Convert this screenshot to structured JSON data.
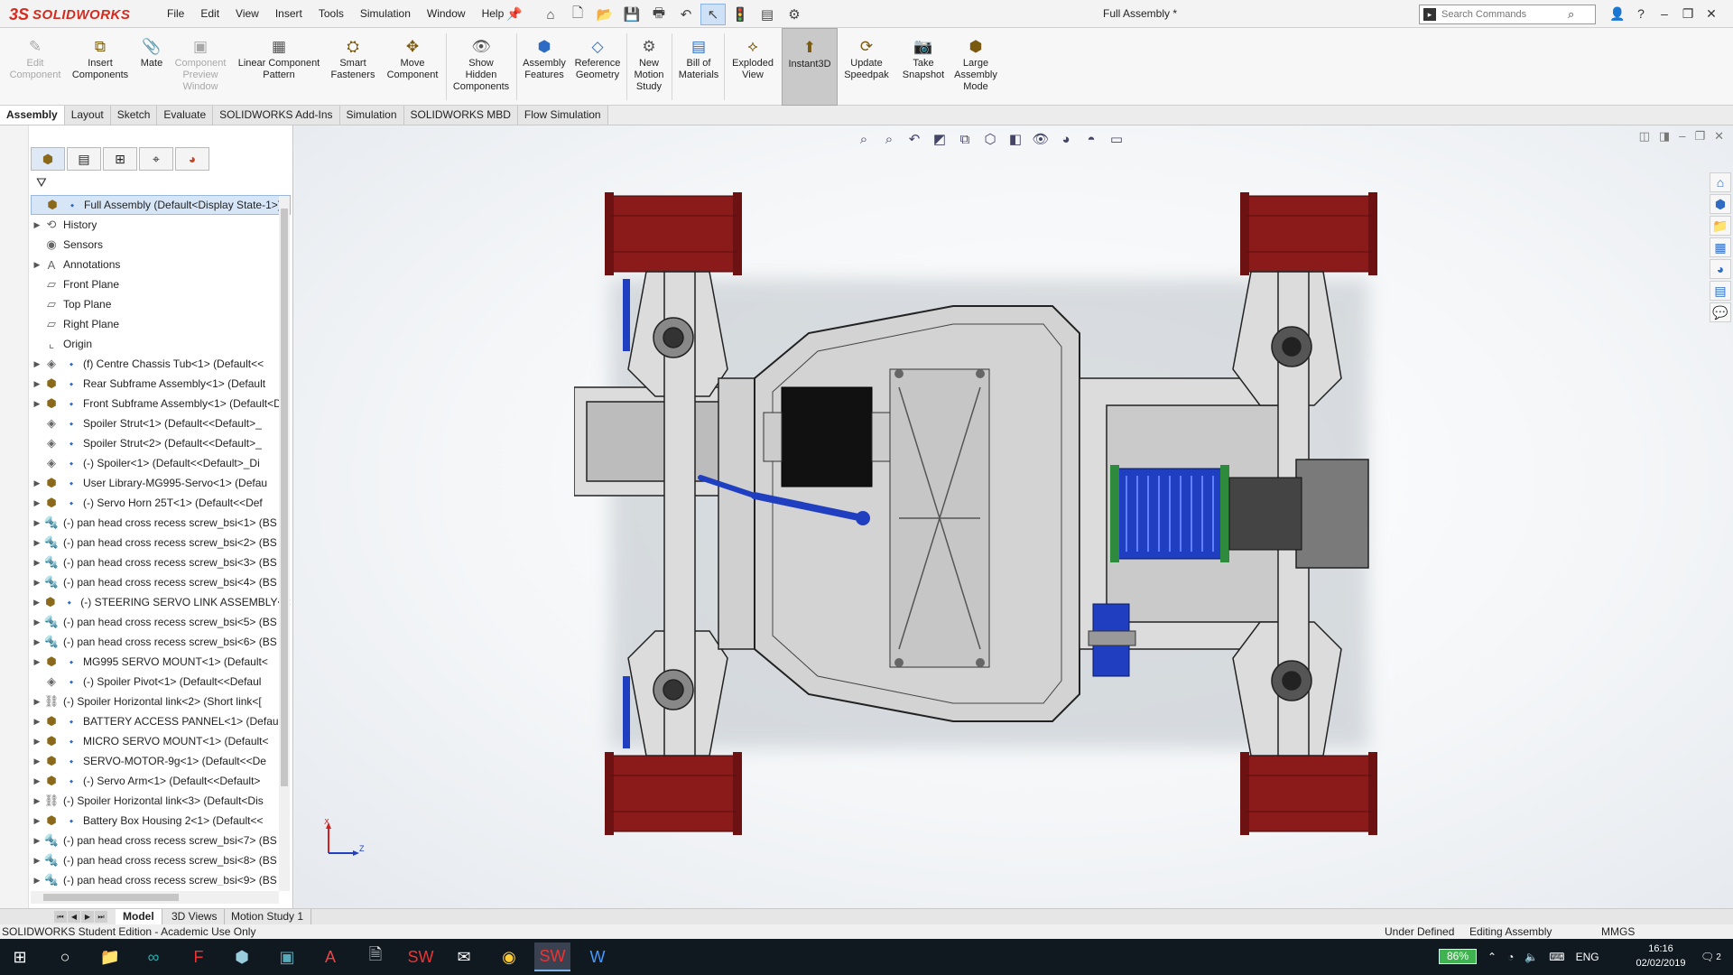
{
  "app": {
    "logo_ds": "3S",
    "logo_text": "SOLIDWORKS",
    "doc_title": "Full Assembly *"
  },
  "menu": [
    "File",
    "Edit",
    "View",
    "Insert",
    "Tools",
    "Simulation",
    "Window",
    "Help"
  ],
  "search": {
    "placeholder": "Search Commands"
  },
  "commands": [
    {
      "label": "Edit\nComponent",
      "icon": "edit-component-icon",
      "disabled": true
    },
    {
      "label": "Insert\nComponents",
      "icon": "insert-components-icon"
    },
    {
      "label": "Mate",
      "icon": "mate-icon"
    },
    {
      "label": "Component\nPreview\nWindow",
      "icon": "component-preview-icon",
      "disabled": true
    },
    {
      "label": "Linear Component\nPattern",
      "icon": "linear-pattern-icon"
    },
    {
      "label": "Smart\nFasteners",
      "icon": "smart-fasteners-icon"
    },
    {
      "label": "Move\nComponent",
      "icon": "move-component-icon"
    },
    {
      "label": "Show\nHidden\nComponents",
      "icon": "show-hidden-icon"
    },
    {
      "label": "Assembly\nFeatures",
      "icon": "assembly-features-icon"
    },
    {
      "label": "Reference\nGeometry",
      "icon": "reference-geometry-icon"
    },
    {
      "label": "New\nMotion\nStudy",
      "icon": "motion-study-icon"
    },
    {
      "label": "Bill of\nMaterials",
      "icon": "bom-icon"
    },
    {
      "label": "Exploded\nView",
      "icon": "exploded-view-icon"
    },
    {
      "label": "Instant3D",
      "icon": "instant3d-icon",
      "active": true
    },
    {
      "label": "Update\nSpeedpak",
      "icon": "speedpak-icon"
    },
    {
      "label": "Take\nSnapshot",
      "icon": "snapshot-icon"
    },
    {
      "label": "Large\nAssembly\nMode",
      "icon": "large-assembly-icon"
    }
  ],
  "tabs": [
    "Assembly",
    "Layout",
    "Sketch",
    "Evaluate",
    "SOLIDWORKS Add-Ins",
    "Simulation",
    "SOLIDWORKS MBD",
    "Flow Simulation"
  ],
  "tree": [
    {
      "label": "Full Assembly  (Default<Display State-1>)",
      "icon": "assembly-icon",
      "arrow": "",
      "selected": true
    },
    {
      "label": "History",
      "icon": "history-icon",
      "arrow": "right"
    },
    {
      "label": "Sensors",
      "icon": "sensors-icon",
      "arrow": ""
    },
    {
      "label": "Annotations",
      "icon": "annotations-icon",
      "arrow": "right"
    },
    {
      "label": "Front Plane",
      "icon": "plane-icon",
      "arrow": ""
    },
    {
      "label": "Top Plane",
      "icon": "plane-icon",
      "arrow": ""
    },
    {
      "label": "Right Plane",
      "icon": "plane-icon",
      "arrow": ""
    },
    {
      "label": "Origin",
      "icon": "origin-icon",
      "arrow": ""
    },
    {
      "label": "(f) Centre Chassis Tub<1> (Default<<",
      "icon": "part-icon",
      "arrow": "right"
    },
    {
      "label": "Rear Subframe Assembly<1> (Default",
      "icon": "subassembly-icon",
      "arrow": "right"
    },
    {
      "label": "Front Subframe Assembly<1> (Default<Di",
      "icon": "subassembly-icon",
      "arrow": "right"
    },
    {
      "label": "Spoiler Strut<1> (Default<<Default>_",
      "icon": "part-icon",
      "arrow": ""
    },
    {
      "label": "Spoiler Strut<2> (Default<<Default>_",
      "icon": "part-icon",
      "arrow": ""
    },
    {
      "label": "(-) Spoiler<1> (Default<<Default>_Di",
      "icon": "part-icon",
      "arrow": ""
    },
    {
      "label": "User Library-MG995-Servo<1> (Defau",
      "icon": "subassembly-icon",
      "arrow": "right"
    },
    {
      "label": "(-) Servo Horn 25T<1> (Default<<Def",
      "icon": "subassembly-icon",
      "arrow": "right"
    },
    {
      "label": "(-) pan head cross recess screw_bsi<1> (BS",
      "icon": "screw-icon",
      "arrow": "right"
    },
    {
      "label": "(-) pan head cross recess screw_bsi<2> (BS",
      "icon": "screw-icon",
      "arrow": "right"
    },
    {
      "label": "(-) pan head cross recess screw_bsi<3> (BS",
      "icon": "screw-icon",
      "arrow": "right"
    },
    {
      "label": "(-) pan head cross recess screw_bsi<4> (BS",
      "icon": "screw-icon",
      "arrow": "right"
    },
    {
      "label": "(-) STEERING SERVO LINK ASSEMBLY<1> (",
      "icon": "subassembly-icon",
      "arrow": "right"
    },
    {
      "label": "(-) pan head cross recess screw_bsi<5> (BS",
      "icon": "screw-icon",
      "arrow": "right"
    },
    {
      "label": "(-) pan head cross recess screw_bsi<6> (BS",
      "icon": "screw-icon",
      "arrow": "right"
    },
    {
      "label": "MG995 SERVO MOUNT<1> (Default<",
      "icon": "subassembly-icon",
      "arrow": "right"
    },
    {
      "label": "(-) Spoiler Pivot<1> (Default<<Defaul",
      "icon": "part-icon",
      "arrow": ""
    },
    {
      "label": "(-) Spoiler Horizontal link<2> (Short link<[",
      "icon": "link-icon",
      "arrow": "right"
    },
    {
      "label": "BATTERY ACCESS PANNEL<1> (Defau",
      "icon": "subassembly-icon",
      "arrow": "right"
    },
    {
      "label": "MICRO SERVO MOUNT<1> (Default<",
      "icon": "subassembly-icon",
      "arrow": "right"
    },
    {
      "label": "SERVO-MOTOR-9g<1> (Default<<De",
      "icon": "subassembly-icon",
      "arrow": "right"
    },
    {
      "label": "(-) Servo Arm<1> (Default<<Default>",
      "icon": "subassembly-icon",
      "arrow": "right"
    },
    {
      "label": "(-) Spoiler Horizontal link<3> (Default<Dis",
      "icon": "link-icon",
      "arrow": "right"
    },
    {
      "label": "Battery Box Housing 2<1> (Default<<",
      "icon": "subassembly-icon",
      "arrow": "right"
    },
    {
      "label": "(-) pan head cross recess screw_bsi<7> (BS",
      "icon": "screw-icon",
      "arrow": "right"
    },
    {
      "label": "(-) pan head cross recess screw_bsi<8> (BS",
      "icon": "screw-icon",
      "arrow": "right"
    },
    {
      "label": "(-) pan head cross recess screw_bsi<9> (BS",
      "icon": "screw-icon",
      "arrow": "right"
    }
  ],
  "bottom_tabs": [
    "Model",
    "3D Views",
    "Motion Study 1"
  ],
  "status": {
    "left": "SOLIDWORKS Student Edition - Academic Use Only",
    "defined": "Under Defined",
    "mode": "Editing Assembly",
    "units": "MMGS"
  },
  "triad": {
    "x": "X",
    "z": "Z"
  },
  "taskbar": {
    "battery": "86%",
    "lang": "ENG",
    "time": "16:16",
    "date": "02/02/2019",
    "notifications": "2"
  },
  "colors": {
    "brand": "#d52b1e",
    "wheel": "#8b1a1a",
    "motor": "#1f3fc0",
    "servo": "#111111"
  }
}
